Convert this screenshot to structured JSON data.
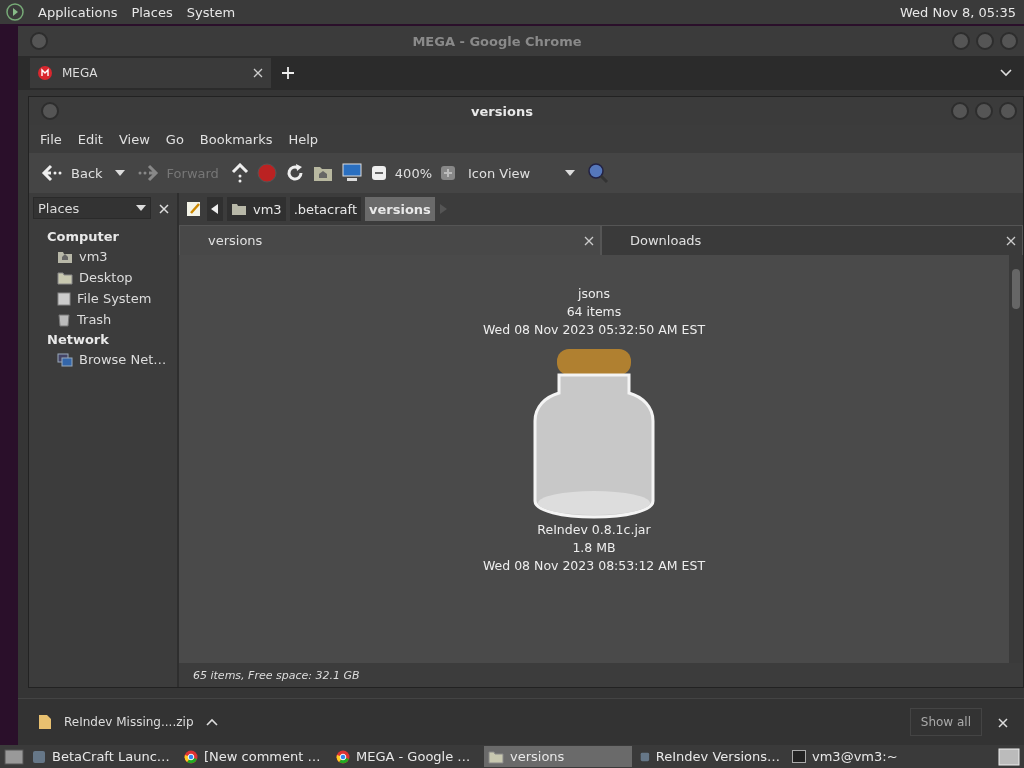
{
  "top_panel": {
    "menus": [
      "Applications",
      "Places",
      "System"
    ],
    "clock": "Wed Nov 8, 05:35"
  },
  "browser": {
    "title": "MEGA - Google Chrome",
    "tabs": [
      {
        "label": "MEGA",
        "selected": true
      }
    ],
    "downloads": {
      "file": "ReIndev Missing....zip",
      "show_all": "Show all"
    }
  },
  "file_manager": {
    "title": "versions",
    "menu": [
      "File",
      "Edit",
      "View",
      "Go",
      "Bookmarks",
      "Help"
    ],
    "toolbar": {
      "back": "Back",
      "forward": "Forward",
      "zoom": "400%",
      "view": "Icon View"
    },
    "sidebar": {
      "header": "Places",
      "sections": [
        {
          "title": "Computer",
          "items": [
            {
              "label": "vm3",
              "kind": "home"
            },
            {
              "label": "Desktop",
              "kind": "desktop"
            },
            {
              "label": "File System",
              "kind": "drive"
            },
            {
              "label": "Trash",
              "kind": "trash"
            }
          ]
        },
        {
          "title": "Network",
          "items": [
            {
              "label": "Browse Net…",
              "kind": "network"
            }
          ]
        }
      ]
    },
    "path": [
      {
        "label": "vm3",
        "selected": false,
        "kind": "home"
      },
      {
        "label": ".betacraft",
        "selected": false
      },
      {
        "label": "versions",
        "selected": true
      }
    ],
    "tabs": [
      {
        "label": "versions",
        "selected": true
      },
      {
        "label": "Downloads",
        "selected": false
      }
    ],
    "items": [
      {
        "name": "jsons",
        "detail": "64 items",
        "date": "Wed 08 Nov 2023 05:32:50 AM EST",
        "kind": "folder"
      },
      {
        "name": "ReIndev 0.8.1c.jar",
        "detail": "1.8 MB",
        "date": "Wed 08 Nov 2023 08:53:12 AM EST",
        "kind": "jar"
      }
    ],
    "status": "65 items, Free space: 32.1 GB"
  },
  "taskbar": [
    {
      "label": "BetaCraft Launc…",
      "selected": false,
      "kind": "app"
    },
    {
      "label": "[New comment …",
      "selected": false,
      "kind": "chrome"
    },
    {
      "label": "MEGA - Google …",
      "selected": false,
      "kind": "chrome"
    },
    {
      "label": "versions",
      "selected": true,
      "kind": "folder"
    },
    {
      "label": "ReIndev Versions…",
      "selected": false,
      "kind": "app"
    },
    {
      "label": "vm3@vm3:~",
      "selected": false,
      "kind": "terminal"
    }
  ]
}
